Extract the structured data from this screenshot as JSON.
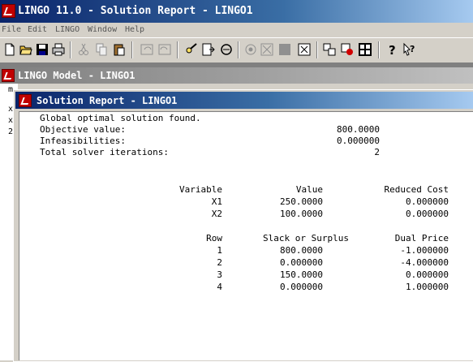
{
  "app": {
    "title": "LINGO 11.0 - Solution Report - LINGO1"
  },
  "menu": [
    "File",
    "Edit",
    "LINGO",
    "Window",
    "Help"
  ],
  "toolbar": {
    "icons": [
      "new-file-icon",
      "open-file-icon",
      "save-icon",
      "print-icon",
      "cut-icon",
      "copy-icon",
      "paste-icon",
      "undo-icon",
      "redo-icon",
      "find-icon",
      "goto-line-icon",
      "match-parenthesis-icon",
      "solve-icon",
      "solution-icon",
      "options-icon",
      "close-all-icon",
      "tile-icon",
      "send-to-back-icon",
      "picture-icon",
      "help-icon",
      "context-help-icon"
    ]
  },
  "model_window": {
    "title": "LINGO Model - LINGO1",
    "gutter": [
      "m",
      "x",
      "x",
      "2"
    ]
  },
  "solution_window": {
    "title": "Solution Report - LINGO1"
  },
  "report": {
    "status": "Global optimal solution found.",
    "objective_label": "Objective value:",
    "objective_value": "800.0000",
    "infeas_label": "Infeasibilities:",
    "infeas_value": "0.000000",
    "iter_label": "Total solver iterations:",
    "iter_value": "2",
    "var_headers": [
      "Variable",
      "Value",
      "Reduced Cost"
    ],
    "variables": [
      [
        "X1",
        "250.0000",
        "0.000000"
      ],
      [
        "X2",
        "100.0000",
        "0.000000"
      ]
    ],
    "row_headers": [
      "Row",
      "Slack or Surplus",
      "Dual Price"
    ],
    "rows": [
      [
        "1",
        "800.0000",
        "-1.000000"
      ],
      [
        "2",
        "0.000000",
        "-4.000000"
      ],
      [
        "3",
        "150.0000",
        "0.000000"
      ],
      [
        "4",
        "0.000000",
        "1.000000"
      ]
    ]
  }
}
